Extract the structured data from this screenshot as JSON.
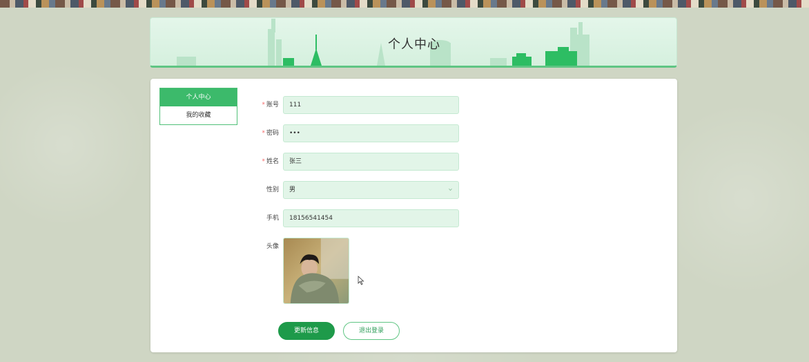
{
  "header": {
    "title": "个人中心"
  },
  "sidebar": {
    "items": [
      {
        "label": "个人中心",
        "active": true
      },
      {
        "label": "我的收藏",
        "active": false
      }
    ]
  },
  "form": {
    "account": {
      "label": "账号",
      "value": "111",
      "required": true
    },
    "password": {
      "label": "密码",
      "value": "•••",
      "required": true
    },
    "name": {
      "label": "姓名",
      "value": "张三",
      "required": true
    },
    "gender": {
      "label": "性别",
      "value": "男",
      "required": false
    },
    "phone": {
      "label": "手机",
      "value": "18156541454",
      "required": false
    },
    "avatar": {
      "label": "头像",
      "icon": "avatar-photo"
    }
  },
  "actions": {
    "update_label": "更新信息",
    "logout_label": "退出登录"
  },
  "colors": {
    "accent": "#3cba6b",
    "primary_button": "#1e9a4a",
    "input_bg": "#e2f5e8",
    "page_bg": "#cfd6c4"
  }
}
